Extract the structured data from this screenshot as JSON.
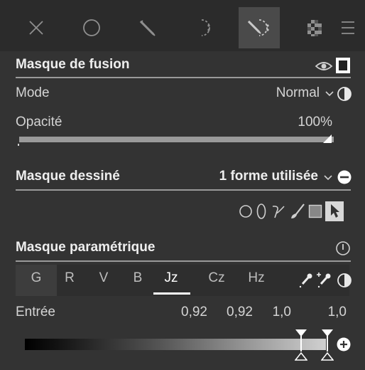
{
  "toolbar": {
    "items": [
      {
        "icon": "close-icon"
      },
      {
        "icon": "circle-icon"
      },
      {
        "icon": "pencil-icon"
      },
      {
        "icon": "parametric-mask-icon"
      },
      {
        "icon": "drawn-parametric-mask-icon",
        "active": true
      },
      {
        "icon": "raster-mask-icon"
      },
      {
        "icon": "menu-icon"
      }
    ]
  },
  "blend_mask": {
    "title": "Masque de fusion",
    "mode_label": "Mode",
    "mode_value": "Normal",
    "opacity_label": "Opacité",
    "opacity_value": "100%",
    "opacity_fraction": 1.0
  },
  "drawn_mask": {
    "title": "Masque dessiné",
    "status": "1 forme utilisée"
  },
  "parametric_mask": {
    "title": "Masque paramétrique",
    "channels": [
      "G",
      "R",
      "V",
      "B",
      "Jz",
      "Cz",
      "Hz"
    ],
    "active_channel": "Jz",
    "input_label": "Entrée",
    "input_values": [
      "0,92",
      "0,92",
      "1,0",
      "1,0"
    ]
  },
  "colors": {
    "background": "#333333",
    "toolbar_bg": "#2b2b2b",
    "active_tool_bg": "#4a4a4a",
    "text": "#dddddd",
    "rule": "#9a9a9a"
  }
}
